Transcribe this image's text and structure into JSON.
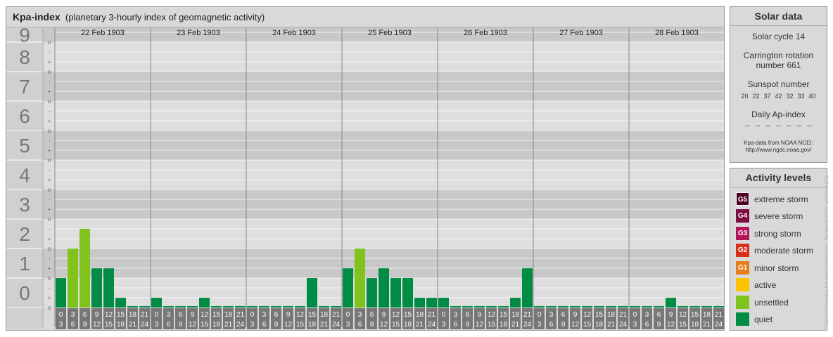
{
  "header": {
    "title": "Kpa-index",
    "subtitle": "(planetary 3-hourly index of geomagnetic activity)"
  },
  "chart_data": {
    "type": "bar",
    "ylim": [
      0,
      9
    ],
    "y_ticks": [
      "0",
      "1",
      "2",
      "3",
      "4",
      "5",
      "6",
      "7",
      "8",
      "9"
    ],
    "minor_ticks": [
      "o",
      "+",
      "-"
    ],
    "days": [
      {
        "label": "22 Feb 1903",
        "values": [
          1.0,
          2.0,
          2.67,
          1.33,
          1.33,
          0.33,
          0,
          0
        ]
      },
      {
        "label": "23 Feb 1903",
        "values": [
          0.33,
          0,
          0,
          0,
          0.33,
          0,
          0,
          0
        ]
      },
      {
        "label": "24 Feb 1903",
        "values": [
          0,
          0,
          0,
          0,
          0,
          1.0,
          0,
          0
        ]
      },
      {
        "label": "25 Feb 1903",
        "values": [
          1.33,
          2.0,
          1.0,
          1.33,
          1.0,
          1.0,
          0.33,
          0.33
        ]
      },
      {
        "label": "26 Feb 1903",
        "values": [
          0.33,
          0,
          0,
          0,
          0,
          0,
          0.33,
          1.33
        ]
      },
      {
        "label": "27 Feb 1903",
        "values": [
          0,
          0,
          0,
          0,
          0,
          0,
          0,
          0
        ]
      },
      {
        "label": "28 Feb 1903",
        "values": [
          0,
          0,
          0,
          0.33,
          0,
          0,
          0,
          0
        ]
      }
    ],
    "interval_labels": [
      [
        "0",
        "3"
      ],
      [
        "3",
        "6"
      ],
      [
        "6",
        "9"
      ],
      [
        "9",
        "12"
      ],
      [
        "12",
        "15"
      ],
      [
        "15",
        "18"
      ],
      [
        "18",
        "21"
      ],
      [
        "21",
        "24"
      ]
    ],
    "colors": {
      "quiet": "#008c44",
      "unsettled": "#7fc31c",
      "active": "#fcc400",
      "G1": "#e57d1e",
      "G2": "#d9301e",
      "G3": "#b4145a",
      "G4": "#7a0c40",
      "G5": "#4b0024"
    }
  },
  "solar": {
    "title": "Solar data",
    "solar_cycle": "Solar cycle 14",
    "carrington_line1": "Carrington rotation",
    "carrington_line2": "number 661",
    "sunspot_title": "Sunspot number",
    "sunspot_values": [
      "20",
      "22",
      "37",
      "42",
      "32",
      "33",
      "40"
    ],
    "ap_title": "Daily Ap-index",
    "ap_values": [
      "--",
      "--",
      "--",
      "--",
      "--",
      "--",
      "--"
    ],
    "source_line1": "Kpa-data from NOAA NCEI:",
    "source_line2": "http://www.ngdc.noaa.gov/"
  },
  "activity": {
    "title": "Activity levels",
    "levels": [
      {
        "code": "G5",
        "label": "extreme storm",
        "color": "#4b0024"
      },
      {
        "code": "G4",
        "label": "severe storm",
        "color": "#7a0c40"
      },
      {
        "code": "G3",
        "label": "strong storm",
        "color": "#b4145a"
      },
      {
        "code": "G2",
        "label": "moderate storm",
        "color": "#d9301e"
      },
      {
        "code": "G1",
        "label": "minor storm",
        "color": "#e57d1e"
      },
      {
        "code": "",
        "label": "active",
        "color": "#fcc400"
      },
      {
        "code": "",
        "label": "unsettled",
        "color": "#7fc31c"
      },
      {
        "code": "",
        "label": "quiet",
        "color": "#008c44"
      }
    ]
  },
  "watermark": "http://www.tesis.lebedev.ru/en/sun_flares.html?m=archive.php"
}
